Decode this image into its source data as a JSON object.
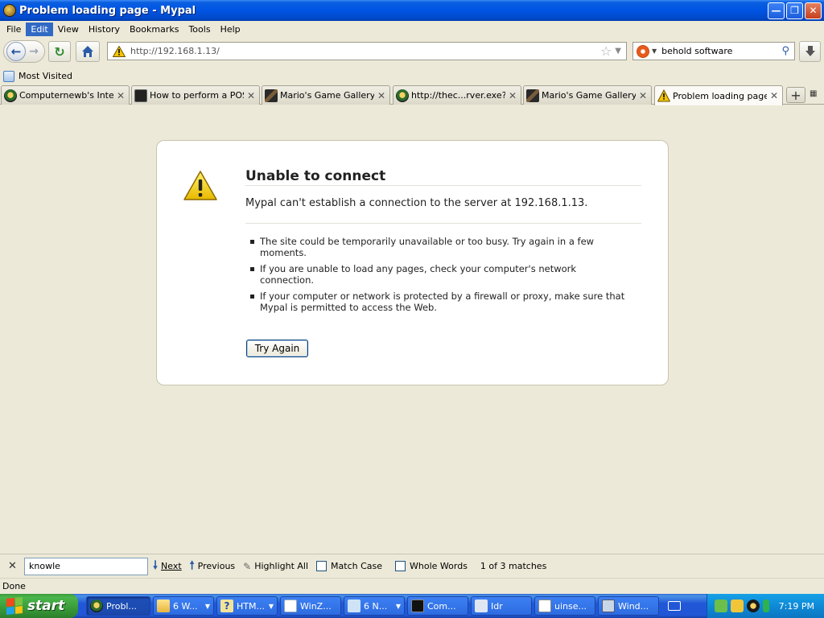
{
  "window": {
    "title": "Problem loading page - Mypal"
  },
  "menu": [
    "File",
    "Edit",
    "View",
    "History",
    "Bookmarks",
    "Tools",
    "Help"
  ],
  "menu_active": "Edit",
  "nav": {
    "url": "http://192.168.1.13/",
    "search_value": "behold software"
  },
  "bookmarks": {
    "most_visited": "Most Visited"
  },
  "tabs": [
    {
      "label": "Computernewb's Inter...",
      "icon": "raccoon-icon"
    },
    {
      "label": "How to perform a POS...",
      "icon": "terminal-icon"
    },
    {
      "label": "Mario's Game Gallery | ...",
      "icon": "mario-icon"
    },
    {
      "label": "http://thec...rver.exe?B",
      "icon": "raccoon-icon"
    },
    {
      "label": "Mario's Game Gallery | ...",
      "icon": "mario-icon"
    },
    {
      "label": "Problem loading page",
      "icon": "warning-icon"
    }
  ],
  "error": {
    "title": "Unable to connect",
    "description": "Mypal can't establish a connection to the server at 192.168.1.13.",
    "items": [
      "The site could be temporarily unavailable or too busy. Try again in a few moments.",
      "If you are unable to load any pages, check your computer's network connection.",
      "If your computer or network is protected by a firewall or proxy, make sure that Mypal is permitted to access the Web."
    ],
    "button": "Try Again"
  },
  "findbar": {
    "query": "knowle",
    "next": "Next",
    "previous": "Previous",
    "highlight_all": "Highlight All",
    "match_case": "Match Case",
    "whole_words": "Whole Words",
    "status": "1 of 3 matches"
  },
  "status": "Done",
  "taskbar": {
    "start": "start",
    "tasks": [
      {
        "label": "Probl...",
        "icon": "raccoon-icon",
        "active": true
      },
      {
        "label": "6 W...",
        "icon": "folder-icon",
        "group": true
      },
      {
        "label": "HTM...",
        "icon": "help-icon",
        "group": true
      },
      {
        "label": "WinZ...",
        "icon": "window-icon"
      },
      {
        "label": "6 N...",
        "icon": "notepad-icon",
        "group": true
      },
      {
        "label": "Com...",
        "icon": "cmd-icon"
      },
      {
        "label": "Idr",
        "icon": "app-icon"
      },
      {
        "label": "uinse...",
        "icon": "document-icon"
      },
      {
        "label": "Wind...",
        "icon": "computer-icon"
      }
    ],
    "clock": "7:19 PM"
  }
}
